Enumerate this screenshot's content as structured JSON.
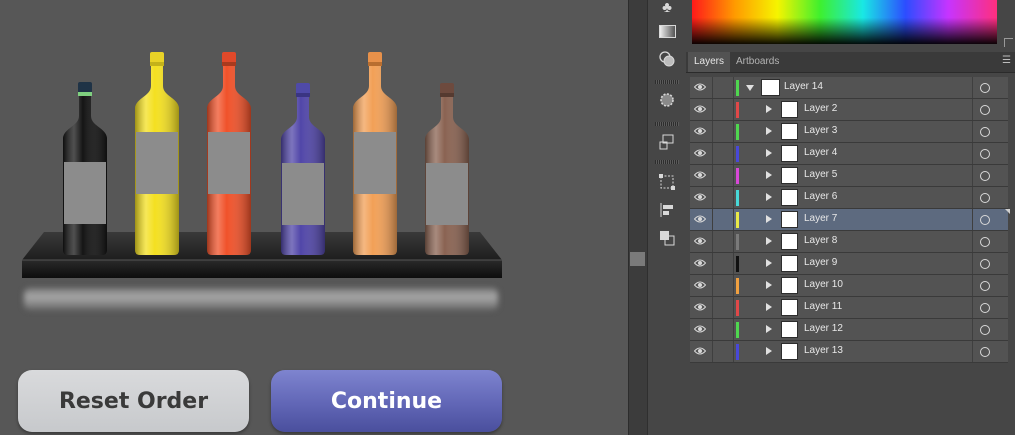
{
  "canvas": {
    "buttons": {
      "reset_label": "Reset Order",
      "continue_label": "Continue"
    },
    "bottles": [
      {
        "name": "black-bottle",
        "body": "#151515",
        "cap": "#1f3346",
        "ring": "#7fd07f"
      },
      {
        "name": "yellow-bottle",
        "body": "#f4e021",
        "cap": "#e9d227",
        "ring": "#c4b21a"
      },
      {
        "name": "red-bottle",
        "body": "#f0522a",
        "cap": "#e0492a",
        "ring": "#a93a1e"
      },
      {
        "name": "purple-bottle",
        "body": "#5146a8",
        "cap": "#4f4aa8",
        "ring": "#3a3582"
      },
      {
        "name": "orange-bottle",
        "body": "#f2a057",
        "cap": "#e8914a",
        "ring": "#b86e30"
      },
      {
        "name": "brown-bottle",
        "body": "#8a6352",
        "cap": "#6d4a3e",
        "ring": "#553a30"
      }
    ]
  },
  "panels": {
    "tabs": [
      "Layers",
      "Artboards"
    ],
    "menu_icon": "panel-menu-icon"
  },
  "layers": [
    {
      "label": "Layer 14",
      "color": "#4fd64f",
      "expanded": true,
      "top": true
    },
    {
      "label": "Layer 2",
      "color": "#e04848"
    },
    {
      "label": "Layer 3",
      "color": "#4fd64f"
    },
    {
      "label": "Layer 4",
      "color": "#4848d8"
    },
    {
      "label": "Layer 5",
      "color": "#d848d8"
    },
    {
      "label": "Layer 6",
      "color": "#48d8d8"
    },
    {
      "label": "Layer 7",
      "color": "#e8e848",
      "selected": true
    },
    {
      "label": "Layer 8",
      "color": "#7a7a7a"
    },
    {
      "label": "Layer 9",
      "color": "#111111"
    },
    {
      "label": "Layer 10",
      "color": "#f0a040"
    },
    {
      "label": "Layer 11",
      "color": "#e04848"
    },
    {
      "label": "Layer 12",
      "color": "#4fd64f"
    },
    {
      "label": "Layer 13",
      "color": "#4848d8"
    }
  ]
}
